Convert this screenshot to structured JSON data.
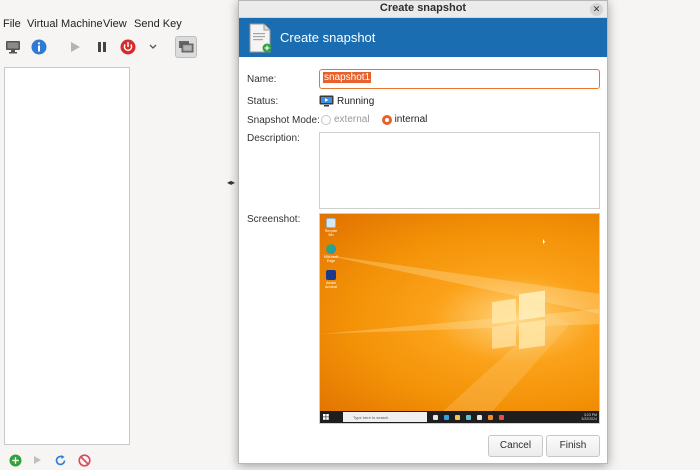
{
  "menu": [
    "File",
    "Virtual Machine",
    "View",
    "Send Key"
  ],
  "dialog": {
    "window_title": "Create snapshot",
    "banner_title": "Create snapshot",
    "labels": {
      "name": "Name:",
      "status": "Status:",
      "mode": "Snapshot Mode:",
      "description": "Description:",
      "screenshot": "Screenshot:"
    },
    "name_value": "snapshot1",
    "status_value": "Running",
    "mode_options": [
      {
        "label": "external",
        "selected": false,
        "enabled": false
      },
      {
        "label": "internal",
        "selected": true,
        "enabled": true
      }
    ],
    "description_value": "",
    "buttons": {
      "cancel": "Cancel",
      "finish": "Finish"
    }
  },
  "screenshot_preview": {
    "search_placeholder": "Type here to search",
    "desktop_icons": [
      "Recycle Bin",
      "Microsoft Edge",
      "Adobe Acrobat"
    ],
    "clock_time": "3:23 PM",
    "clock_date": "3/22/2024"
  },
  "colors": {
    "banner": "#1a6db1",
    "accent": "#e8612c",
    "power": "#d72b2b"
  }
}
